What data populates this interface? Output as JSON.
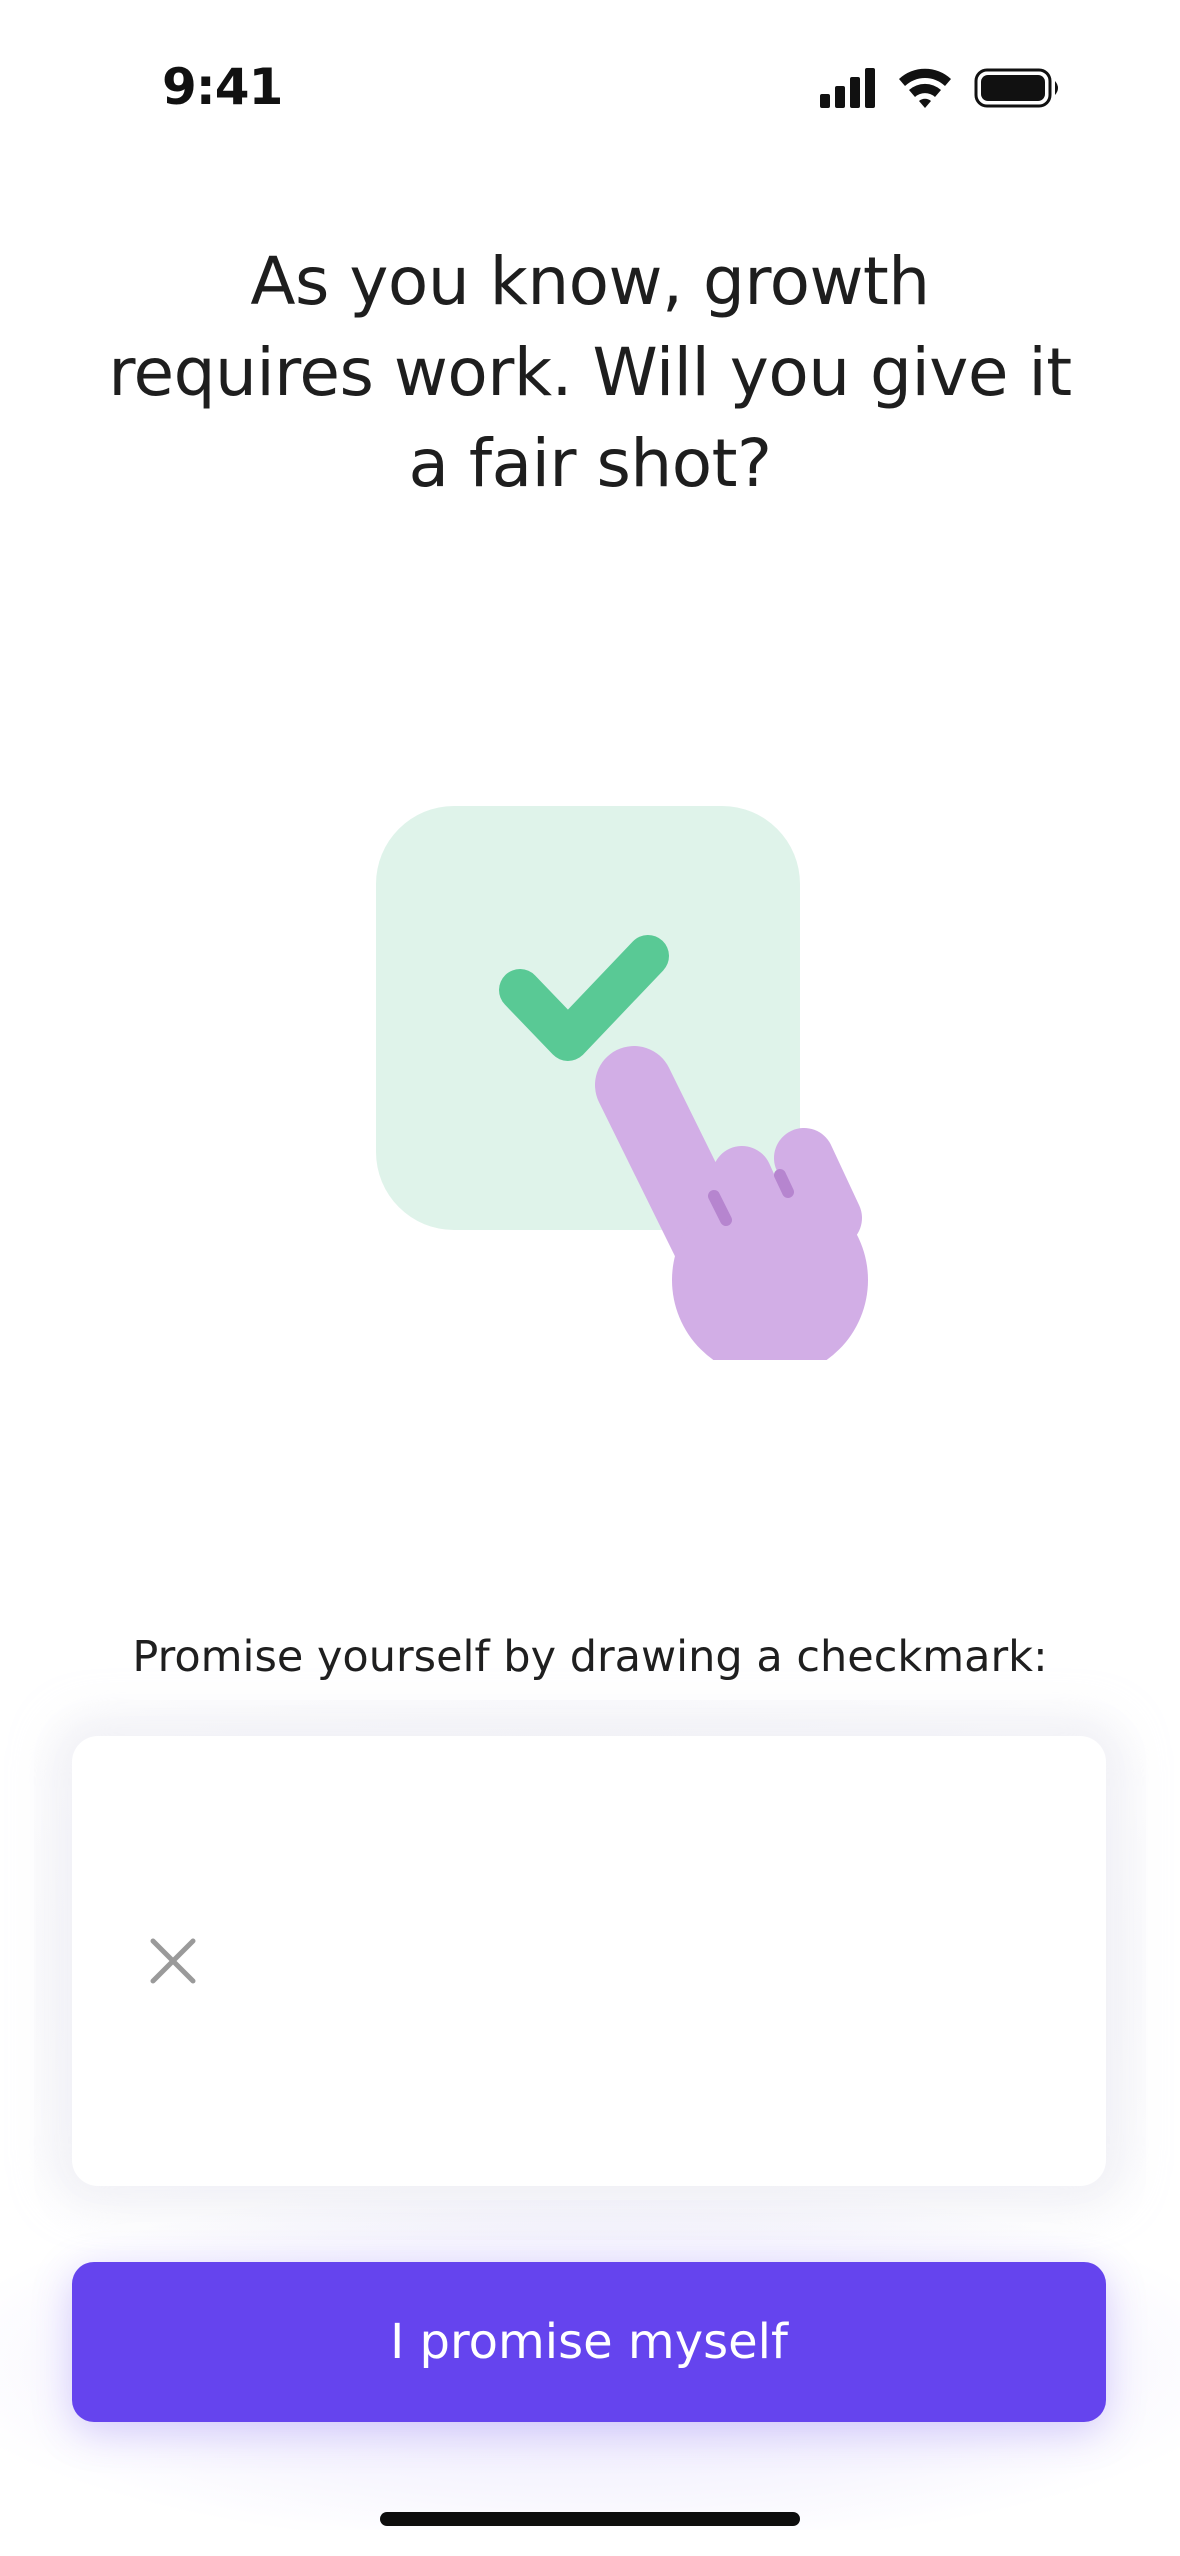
{
  "status_bar": {
    "time": "9:41",
    "icons": [
      "signal-icon",
      "wifi-icon",
      "battery-icon"
    ]
  },
  "headline": {
    "line1": "As you know, growth",
    "line2": "requires work. Will you give it",
    "line3": "a fair shot?"
  },
  "illustration": {
    "icons": [
      "checkmark-icon",
      "hand-pointer-icon"
    ],
    "colors": {
      "card": "#dff3ea",
      "check": "#59c995",
      "hand": "#d2aee6",
      "hand_line": "#b685cf"
    }
  },
  "drawing": {
    "prompt": "Promise yourself by drawing a checkmark:",
    "clear_icon": "close-icon"
  },
  "cta": {
    "label": "I promise myself",
    "color": "#6544ee"
  }
}
